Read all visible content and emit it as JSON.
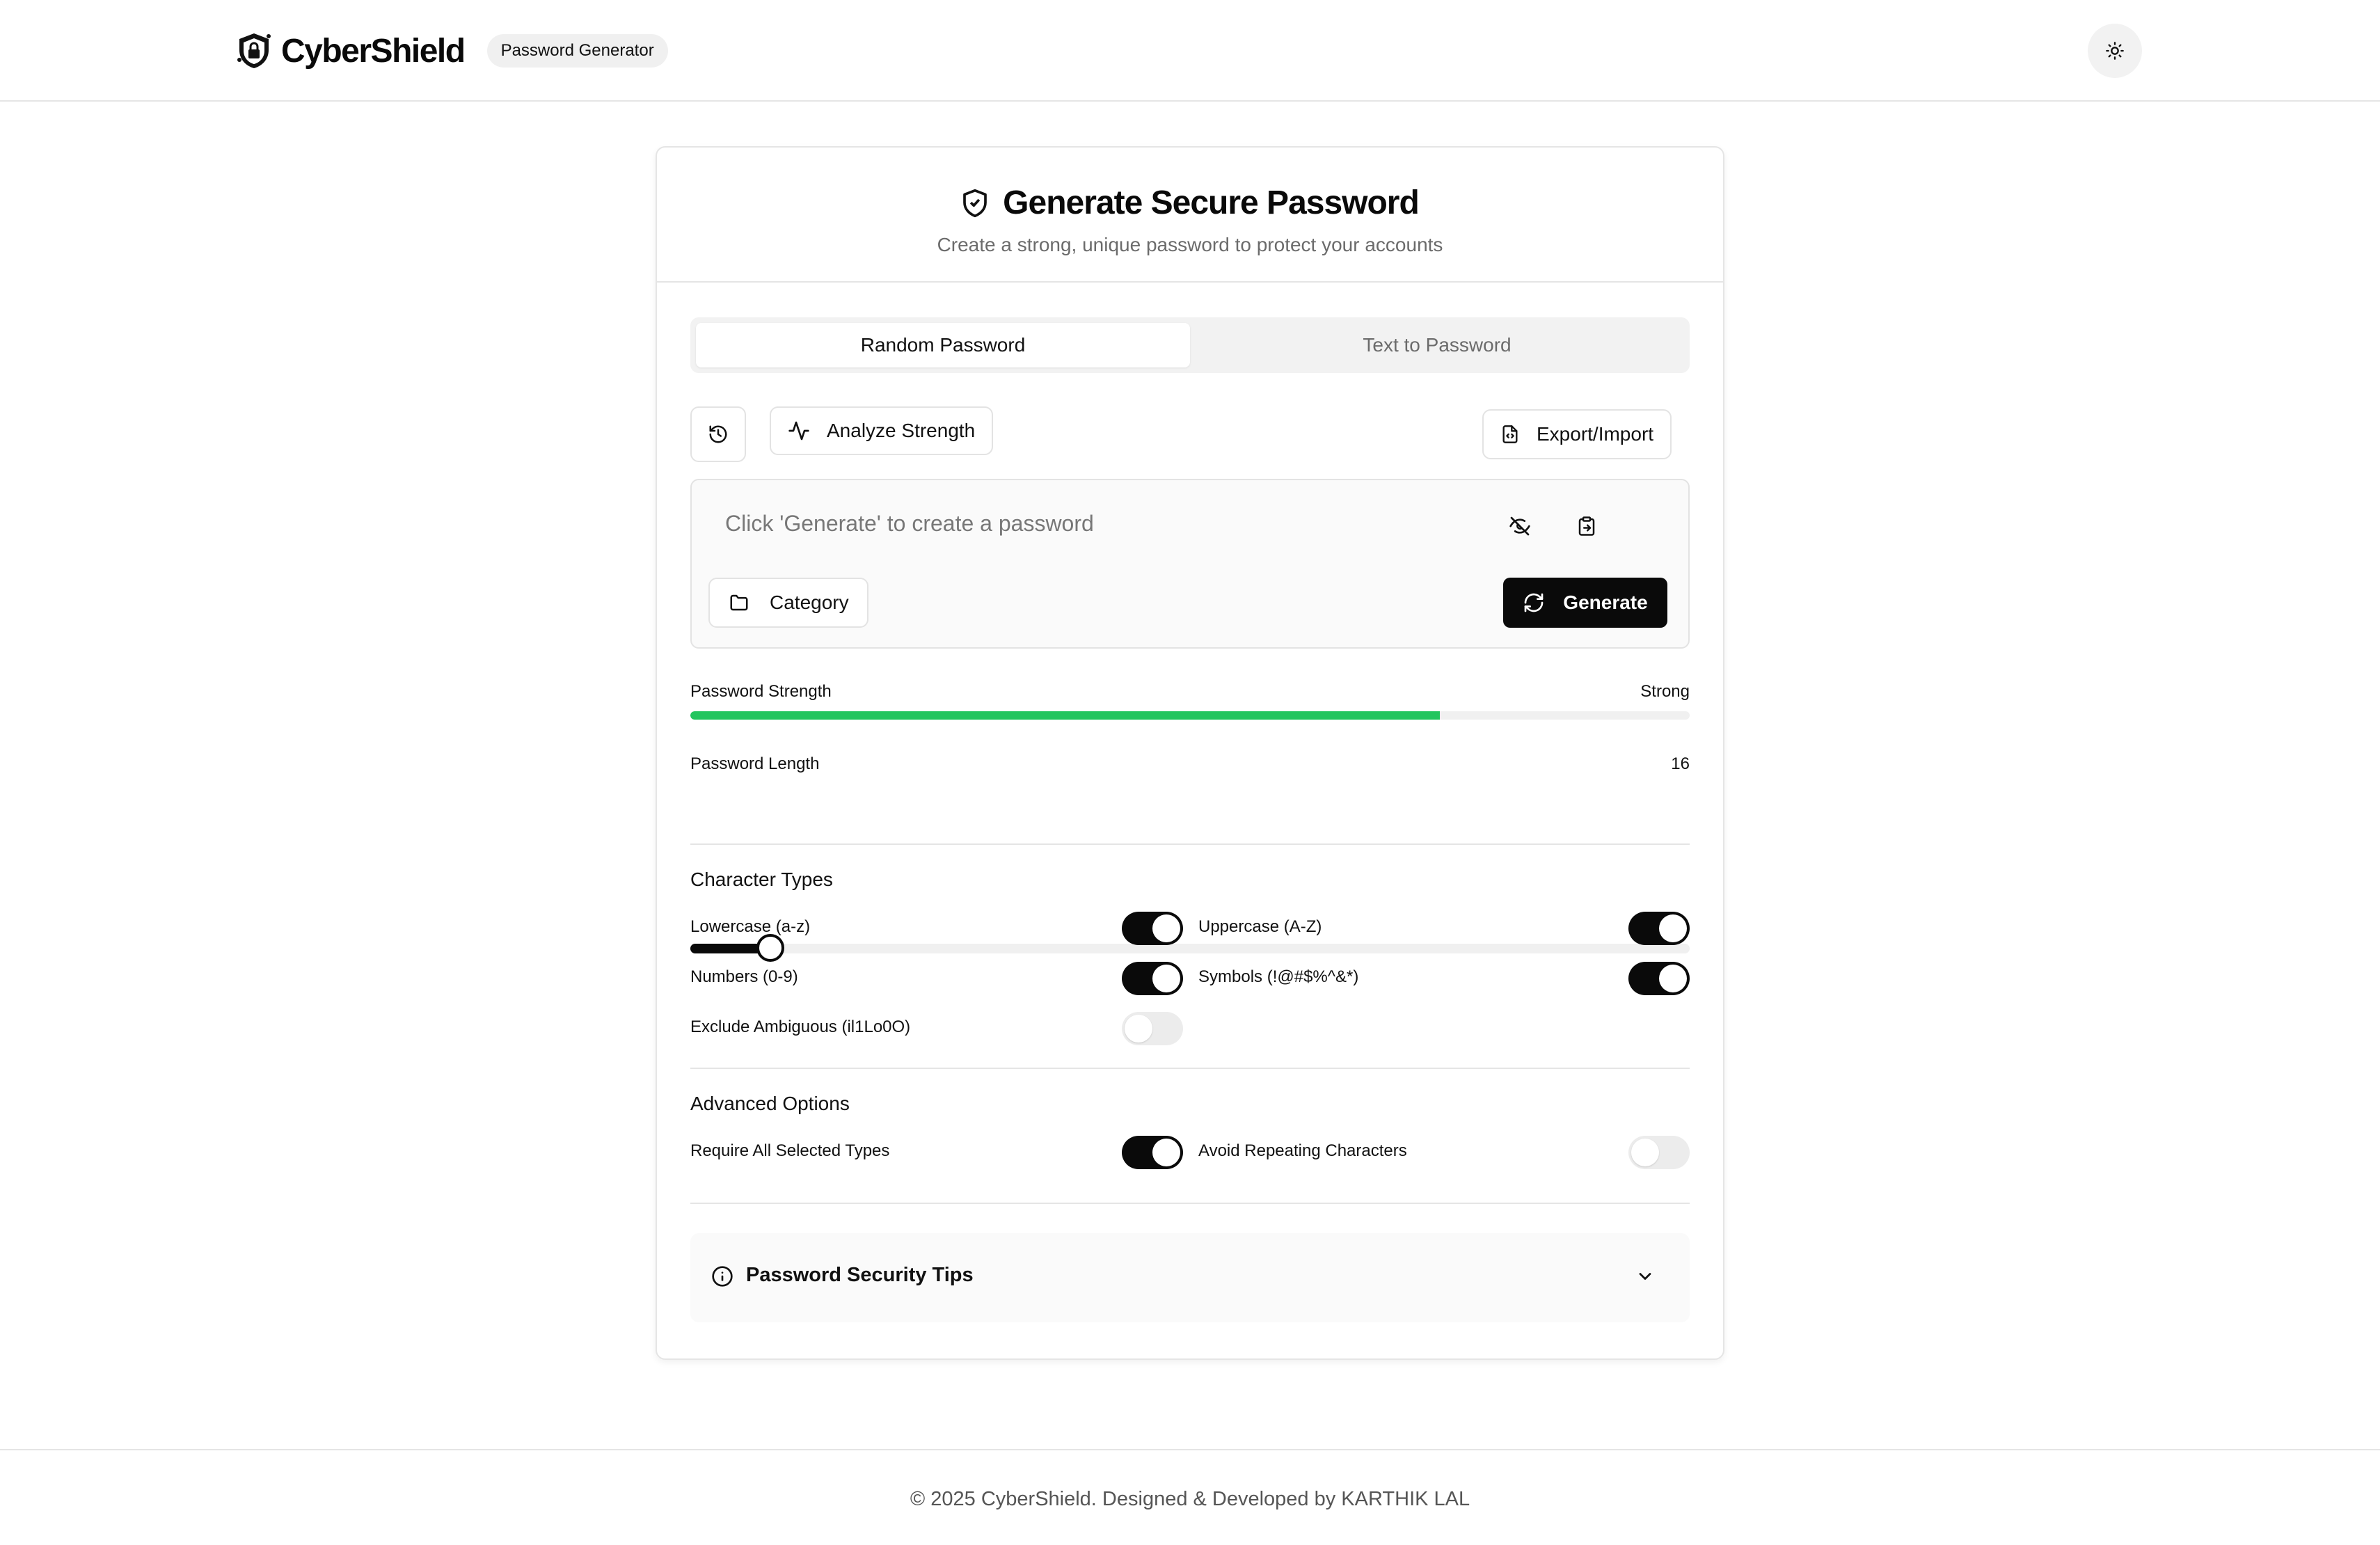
{
  "header": {
    "brand_name": "CyberShield",
    "badge": "Password Generator",
    "theme_icon": "sun-icon"
  },
  "card": {
    "title": "Generate Secure Password",
    "subtitle": "Create a strong, unique password to protect your accounts",
    "title_icon": "shield-icon"
  },
  "tabs": [
    {
      "label": "Random Password",
      "active": true
    },
    {
      "label": "Text to Password",
      "active": false
    }
  ],
  "toolbar": {
    "history_icon": "history-icon",
    "analyze_label": "Analyze Strength",
    "export_label": "Export/Import"
  },
  "password": {
    "placeholder": "Click 'Generate' to create a password",
    "category_label": "Category",
    "generate_label": "Generate"
  },
  "strength": {
    "label": "Password Strength",
    "value": "Strong",
    "fraction": 0.75,
    "color": "#22c55e"
  },
  "length": {
    "label": "Password Length",
    "value": "16",
    "fraction": 0.08
  },
  "character_types": {
    "heading": "Character Types",
    "options": [
      {
        "label": "Lowercase (a-z)",
        "on": true
      },
      {
        "label": "Uppercase (A-Z)",
        "on": true
      },
      {
        "label": "Numbers (0-9)",
        "on": true
      },
      {
        "label": "Symbols (!@#$%^&*)",
        "on": true
      },
      {
        "label": "Exclude Ambiguous (il1Lo0O)",
        "on": false
      }
    ]
  },
  "advanced": {
    "heading": "Advanced Options",
    "options": [
      {
        "label": "Require All Selected Types",
        "on": true
      },
      {
        "label": "Avoid Repeating Characters",
        "on": false
      }
    ]
  },
  "tips": {
    "title": "Password Security Tips"
  },
  "footer": {
    "text": "© 2025 CyberShield. Designed & Developed by KARTHIK LAL"
  }
}
